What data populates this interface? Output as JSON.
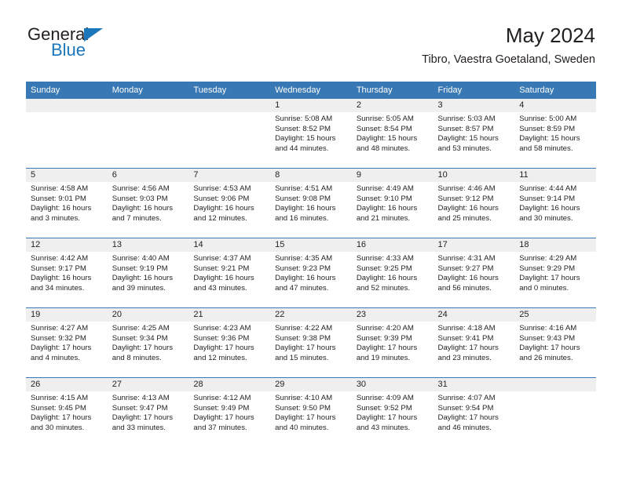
{
  "brand": {
    "name_top": "General",
    "name_bottom": "Blue",
    "accent_color": "#1b76bc"
  },
  "header": {
    "title": "May 2024",
    "subtitle": "Tibro, Vaestra Goetaland, Sweden"
  },
  "theme": {
    "header_bg": "#3878b4",
    "day_band_bg": "#efefef",
    "text_color": "#231f20"
  },
  "labels": {
    "sunrise": "Sunrise:",
    "sunset": "Sunset:",
    "daylight": "Daylight:"
  },
  "weekdays": [
    "Sunday",
    "Monday",
    "Tuesday",
    "Wednesday",
    "Thursday",
    "Friday",
    "Saturday"
  ],
  "weeks": [
    [
      {
        "day": ""
      },
      {
        "day": ""
      },
      {
        "day": ""
      },
      {
        "day": "1",
        "sunrise": "Sunrise: 5:08 AM",
        "sunset": "Sunset: 8:52 PM",
        "daylight": "Daylight: 15 hours and 44 minutes."
      },
      {
        "day": "2",
        "sunrise": "Sunrise: 5:05 AM",
        "sunset": "Sunset: 8:54 PM",
        "daylight": "Daylight: 15 hours and 48 minutes."
      },
      {
        "day": "3",
        "sunrise": "Sunrise: 5:03 AM",
        "sunset": "Sunset: 8:57 PM",
        "daylight": "Daylight: 15 hours and 53 minutes."
      },
      {
        "day": "4",
        "sunrise": "Sunrise: 5:00 AM",
        "sunset": "Sunset: 8:59 PM",
        "daylight": "Daylight: 15 hours and 58 minutes."
      }
    ],
    [
      {
        "day": "5",
        "sunrise": "Sunrise: 4:58 AM",
        "sunset": "Sunset: 9:01 PM",
        "daylight": "Daylight: 16 hours and 3 minutes."
      },
      {
        "day": "6",
        "sunrise": "Sunrise: 4:56 AM",
        "sunset": "Sunset: 9:03 PM",
        "daylight": "Daylight: 16 hours and 7 minutes."
      },
      {
        "day": "7",
        "sunrise": "Sunrise: 4:53 AM",
        "sunset": "Sunset: 9:06 PM",
        "daylight": "Daylight: 16 hours and 12 minutes."
      },
      {
        "day": "8",
        "sunrise": "Sunrise: 4:51 AM",
        "sunset": "Sunset: 9:08 PM",
        "daylight": "Daylight: 16 hours and 16 minutes."
      },
      {
        "day": "9",
        "sunrise": "Sunrise: 4:49 AM",
        "sunset": "Sunset: 9:10 PM",
        "daylight": "Daylight: 16 hours and 21 minutes."
      },
      {
        "day": "10",
        "sunrise": "Sunrise: 4:46 AM",
        "sunset": "Sunset: 9:12 PM",
        "daylight": "Daylight: 16 hours and 25 minutes."
      },
      {
        "day": "11",
        "sunrise": "Sunrise: 4:44 AM",
        "sunset": "Sunset: 9:14 PM",
        "daylight": "Daylight: 16 hours and 30 minutes."
      }
    ],
    [
      {
        "day": "12",
        "sunrise": "Sunrise: 4:42 AM",
        "sunset": "Sunset: 9:17 PM",
        "daylight": "Daylight: 16 hours and 34 minutes."
      },
      {
        "day": "13",
        "sunrise": "Sunrise: 4:40 AM",
        "sunset": "Sunset: 9:19 PM",
        "daylight": "Daylight: 16 hours and 39 minutes."
      },
      {
        "day": "14",
        "sunrise": "Sunrise: 4:37 AM",
        "sunset": "Sunset: 9:21 PM",
        "daylight": "Daylight: 16 hours and 43 minutes."
      },
      {
        "day": "15",
        "sunrise": "Sunrise: 4:35 AM",
        "sunset": "Sunset: 9:23 PM",
        "daylight": "Daylight: 16 hours and 47 minutes."
      },
      {
        "day": "16",
        "sunrise": "Sunrise: 4:33 AM",
        "sunset": "Sunset: 9:25 PM",
        "daylight": "Daylight: 16 hours and 52 minutes."
      },
      {
        "day": "17",
        "sunrise": "Sunrise: 4:31 AM",
        "sunset": "Sunset: 9:27 PM",
        "daylight": "Daylight: 16 hours and 56 minutes."
      },
      {
        "day": "18",
        "sunrise": "Sunrise: 4:29 AM",
        "sunset": "Sunset: 9:29 PM",
        "daylight": "Daylight: 17 hours and 0 minutes."
      }
    ],
    [
      {
        "day": "19",
        "sunrise": "Sunrise: 4:27 AM",
        "sunset": "Sunset: 9:32 PM",
        "daylight": "Daylight: 17 hours and 4 minutes."
      },
      {
        "day": "20",
        "sunrise": "Sunrise: 4:25 AM",
        "sunset": "Sunset: 9:34 PM",
        "daylight": "Daylight: 17 hours and 8 minutes."
      },
      {
        "day": "21",
        "sunrise": "Sunrise: 4:23 AM",
        "sunset": "Sunset: 9:36 PM",
        "daylight": "Daylight: 17 hours and 12 minutes."
      },
      {
        "day": "22",
        "sunrise": "Sunrise: 4:22 AM",
        "sunset": "Sunset: 9:38 PM",
        "daylight": "Daylight: 17 hours and 15 minutes."
      },
      {
        "day": "23",
        "sunrise": "Sunrise: 4:20 AM",
        "sunset": "Sunset: 9:39 PM",
        "daylight": "Daylight: 17 hours and 19 minutes."
      },
      {
        "day": "24",
        "sunrise": "Sunrise: 4:18 AM",
        "sunset": "Sunset: 9:41 PM",
        "daylight": "Daylight: 17 hours and 23 minutes."
      },
      {
        "day": "25",
        "sunrise": "Sunrise: 4:16 AM",
        "sunset": "Sunset: 9:43 PM",
        "daylight": "Daylight: 17 hours and 26 minutes."
      }
    ],
    [
      {
        "day": "26",
        "sunrise": "Sunrise: 4:15 AM",
        "sunset": "Sunset: 9:45 PM",
        "daylight": "Daylight: 17 hours and 30 minutes."
      },
      {
        "day": "27",
        "sunrise": "Sunrise: 4:13 AM",
        "sunset": "Sunset: 9:47 PM",
        "daylight": "Daylight: 17 hours and 33 minutes."
      },
      {
        "day": "28",
        "sunrise": "Sunrise: 4:12 AM",
        "sunset": "Sunset: 9:49 PM",
        "daylight": "Daylight: 17 hours and 37 minutes."
      },
      {
        "day": "29",
        "sunrise": "Sunrise: 4:10 AM",
        "sunset": "Sunset: 9:50 PM",
        "daylight": "Daylight: 17 hours and 40 minutes."
      },
      {
        "day": "30",
        "sunrise": "Sunrise: 4:09 AM",
        "sunset": "Sunset: 9:52 PM",
        "daylight": "Daylight: 17 hours and 43 minutes."
      },
      {
        "day": "31",
        "sunrise": "Sunrise: 4:07 AM",
        "sunset": "Sunset: 9:54 PM",
        "daylight": "Daylight: 17 hours and 46 minutes."
      },
      {
        "day": ""
      }
    ]
  ]
}
